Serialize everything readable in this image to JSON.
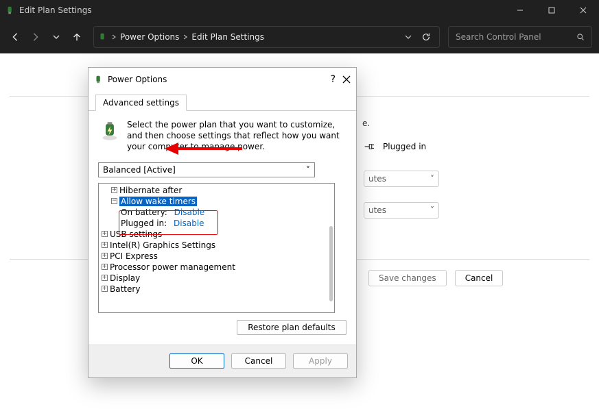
{
  "titlebar": {
    "title": "Edit Plan Settings"
  },
  "navbar": {
    "crumbs": [
      "Power Options",
      "Edit Plan Settings"
    ],
    "search_placeholder": "Search Control Panel"
  },
  "bgpage": {
    "sentence_tail": "e.",
    "plugged_label": "Plugged in",
    "combo1": "utes",
    "combo2": "utes",
    "save": "Save changes",
    "cancel": "Cancel"
  },
  "dialog": {
    "title": "Power Options",
    "tab": "Advanced settings",
    "description": "Select the power plan that you want to customize, and then choose settings that reflect how you want your computer to manage power.",
    "plan": "Balanced [Active]",
    "tree": [
      "Hibernate after",
      "Allow wake timers",
      "USB settings",
      "Intel(R) Graphics Settings",
      "PCI Express",
      "Processor power management",
      "Display",
      "Battery"
    ],
    "wake": {
      "on_battery_label": "On battery:",
      "on_battery_value": "Disable",
      "plugged_label": "Plugged in:",
      "plugged_value": "Disable"
    },
    "restore": "Restore plan defaults",
    "ok": "OK",
    "cancel": "Cancel",
    "apply": "Apply"
  }
}
